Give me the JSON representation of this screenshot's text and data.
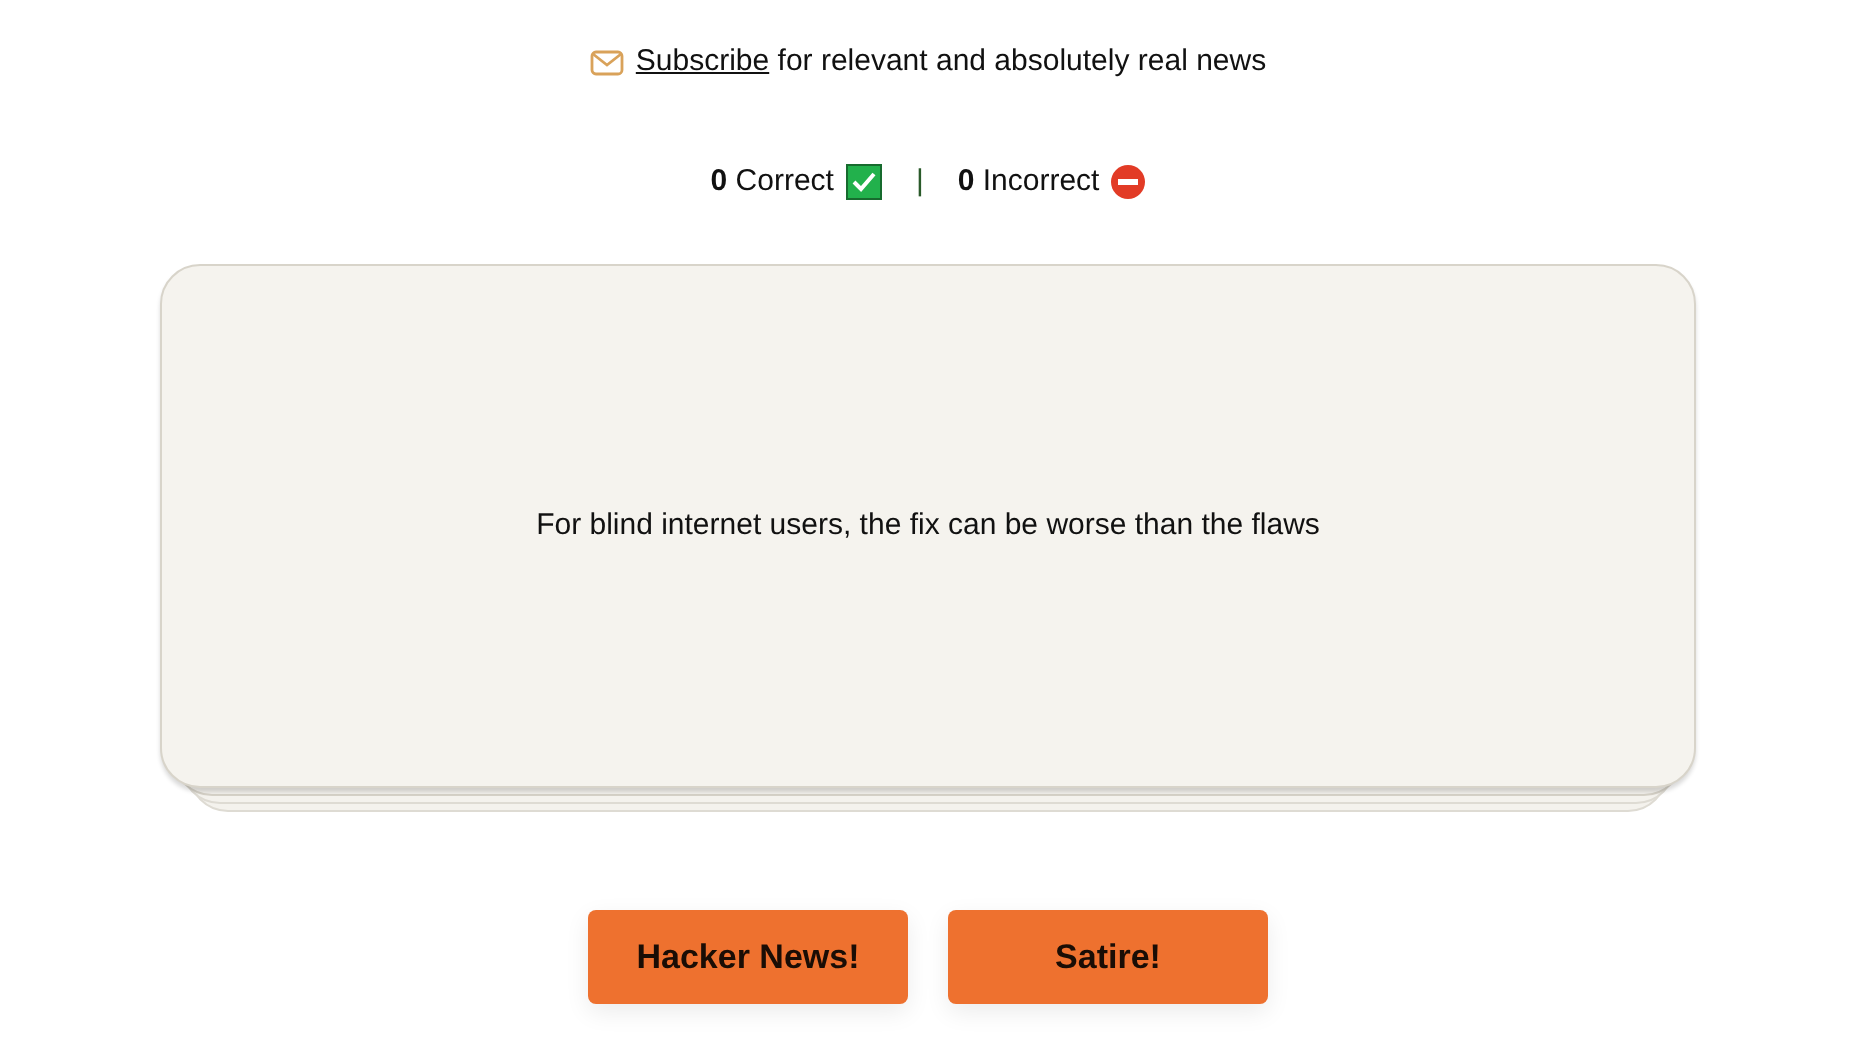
{
  "subscribe": {
    "link": "Subscribe",
    "text": "for relevant and absolutely real news"
  },
  "score": {
    "correct": "**0** Correct",
    "separator": "|",
    "incorrect": "**0** Incorrect"
  },
  "card": {
    "headline": "For blind internet users, the fix can be worse than the flaws"
  },
  "buttons": [
    "Hacker News!",
    "Satire!"
  ]
}
